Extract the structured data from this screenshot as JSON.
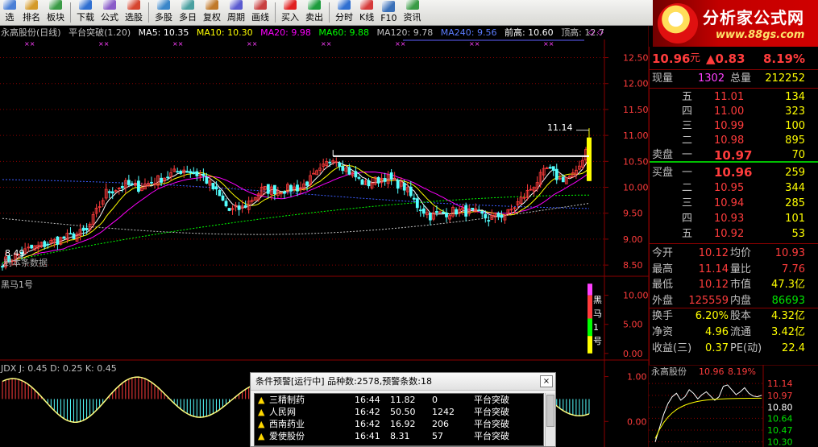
{
  "toolbar": {
    "items": [
      {
        "label": "选",
        "icon": "select-icon",
        "color": "#4a7fd6"
      },
      {
        "label": "排名",
        "icon": "rank-icon",
        "color": "#d49a2a"
      },
      {
        "label": "板块",
        "icon": "sector-icon",
        "color": "#3a9b46"
      },
      {
        "label": "下载",
        "icon": "download-icon",
        "color": "#2f6fd1"
      },
      {
        "label": "公式",
        "icon": "formula-icon",
        "color": "#8a5cc8"
      },
      {
        "label": "选股",
        "icon": "stock-pick-icon",
        "color": "#d6452f"
      },
      {
        "label": "多股",
        "icon": "multi-stock-icon",
        "color": "#3a86c9"
      },
      {
        "label": "多日",
        "icon": "multi-day-icon",
        "color": "#4aa0a0"
      },
      {
        "label": "复权",
        "icon": "adjust-icon",
        "color": "#c0792a"
      },
      {
        "label": "周期",
        "icon": "period-icon",
        "color": "#5a5ad0"
      },
      {
        "label": "画线",
        "icon": "draw-line-icon",
        "color": "#c83f3f"
      },
      {
        "label": "买入",
        "icon": "buy-icon",
        "color": "#e02020"
      },
      {
        "label": "卖出",
        "icon": "sell-icon",
        "color": "#1c9c3c"
      },
      {
        "label": "分时",
        "icon": "intraday-icon",
        "color": "#2f6fd1"
      },
      {
        "label": "K线",
        "icon": "kline-icon",
        "color": "#d63a3a"
      },
      {
        "label": "F10",
        "icon": "f10-icon",
        "color": "#3a70b8"
      },
      {
        "label": "资讯",
        "icon": "news-icon",
        "color": "#3a9b46"
      }
    ]
  },
  "logo": {
    "title": "分析家公式网",
    "url": "www.88gs.com"
  },
  "header": {
    "stock": "永高股份(日线)",
    "formula": "平台突破(1.20)",
    "ma5": "MA5: 10.35",
    "ma10": "MA10: 10.30",
    "ma20": "MA20: 9.98",
    "ma60": "MA60: 9.88",
    "ma120": "MA120: 9.78",
    "ma240": "MA240: 9.56",
    "prev_high": "前高: 10.60",
    "top_high": "顶高: 12.72"
  },
  "colors": {
    "up": "#ff3c3c",
    "down": "#54ffff",
    "ma5": "#ffffff",
    "ma10": "#ffff00",
    "ma20": "#ff00ff",
    "ma60": "#00ff00",
    "ma120": "#c0c0c0",
    "ma240": "#3c5cff",
    "grid": "#8b0000"
  },
  "main_chart": {
    "y_ticks": [
      "12.50",
      "12.00",
      "11.50",
      "11.00",
      "10.50",
      "10.00",
      "9.50",
      "9.00",
      "8.50"
    ],
    "platform_label": "11.14",
    "low_label": "8.49",
    "watermark": "到本条数据"
  },
  "blackhorse": {
    "name": "黑马1号",
    "y_ticks": [
      "10.00",
      "5.00",
      "0.00"
    ],
    "side_chars": [
      "黑",
      "马",
      "1",
      "号"
    ]
  },
  "kdj": {
    "label": "JDX J: 0.45  D: 0.25  K: 0.45",
    "y_ticks": [
      "1.00",
      "0.00"
    ]
  },
  "quote": {
    "price": "10.96",
    "price_unit": "元",
    "change": "▲0.83",
    "change_pct": "8.19%",
    "volume_now_label": "现量",
    "volume_now": "1302",
    "volume_total_label": "总量",
    "volume_total": "212252",
    "sell_label": "卖盘",
    "buy_label": "买盘",
    "asks": [
      {
        "level": "五",
        "price": "11.01",
        "vol": "134"
      },
      {
        "level": "四",
        "price": "11.00",
        "vol": "323"
      },
      {
        "level": "三",
        "price": "10.99",
        "vol": "100"
      },
      {
        "level": "二",
        "price": "10.98",
        "vol": "895"
      },
      {
        "level": "一",
        "price": "10.97",
        "vol": "70"
      }
    ],
    "bids": [
      {
        "level": "一",
        "price": "10.96",
        "vol": "259"
      },
      {
        "level": "二",
        "price": "10.95",
        "vol": "344"
      },
      {
        "level": "三",
        "price": "10.94",
        "vol": "285"
      },
      {
        "level": "四",
        "price": "10.93",
        "vol": "101"
      },
      {
        "level": "五",
        "price": "10.92",
        "vol": "53"
      }
    ],
    "stats": [
      {
        "l1": "今开",
        "v1": "10.12",
        "c1": "#ff3c3c",
        "l2": "均价",
        "v2": "10.93",
        "c2": "#ff3c3c"
      },
      {
        "l1": "最高",
        "v1": "11.14",
        "c1": "#ff3c3c",
        "l2": "量比",
        "v2": "7.76",
        "c2": "#ff3c3c"
      },
      {
        "l1": "最低",
        "v1": "10.12",
        "c1": "#ff3c3c",
        "l2": "市值",
        "v2": "47.3亿",
        "c2": "#ffff00"
      },
      {
        "l1": "外盘",
        "v1": "125559",
        "c1": "#ff3c3c",
        "l2": "内盘",
        "v2": "86693",
        "c2": "#00e600"
      },
      {
        "l1": "换手",
        "v1": "6.20%",
        "c1": "#ffff00",
        "l2": "股本",
        "v2": "4.32亿",
        "c2": "#ffff00"
      },
      {
        "l1": "净资",
        "v1": "4.96",
        "c1": "#ffff00",
        "l2": "流通",
        "v2": "3.42亿",
        "c2": "#ffff00"
      },
      {
        "l1": "收益(三)",
        "v1": "0.37",
        "c1": "#ffff00",
        "l2": "PE(动)",
        "v2": "22.4",
        "c2": "#ffff00"
      }
    ]
  },
  "mini_chart": {
    "name": "永高股份",
    "price": "10.96",
    "pct": "8.19%",
    "y_ticks": [
      "11.14",
      "10.97",
      "10.80",
      "10.64",
      "10.47",
      "10.30"
    ]
  },
  "alert": {
    "title": "条件预警[运行中] 品种数:2578,预警条数:18",
    "close": "×",
    "rows": [
      {
        "name": "三精制药",
        "time": "16:44",
        "price": "11.82",
        "vol": "0",
        "signal": "平台突破"
      },
      {
        "name": "人民网",
        "time": "16:42",
        "price": "50.50",
        "vol": "1242",
        "signal": "平台突破"
      },
      {
        "name": "西南药业",
        "time": "16:42",
        "price": "16.92",
        "vol": "206",
        "signal": "平台突破"
      },
      {
        "name": "爱使股份",
        "time": "16:41",
        "price": "8.31",
        "vol": "57",
        "signal": "平台突破"
      }
    ]
  }
}
